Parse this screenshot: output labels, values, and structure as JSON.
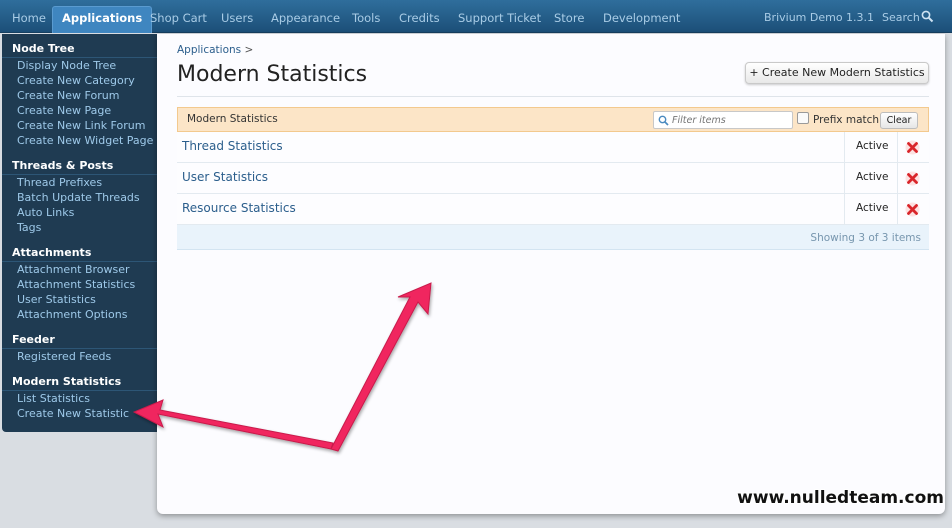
{
  "topnav": {
    "tabs": [
      {
        "label": "Home"
      },
      {
        "label": "Applications"
      },
      {
        "label": "Shop Cart"
      },
      {
        "label": "Users"
      },
      {
        "label": "Appearance"
      },
      {
        "label": "Tools"
      },
      {
        "label": "Credits"
      },
      {
        "label": "Support Ticket"
      },
      {
        "label": "Store"
      },
      {
        "label": "Development"
      }
    ],
    "active_tab": "Applications",
    "site_name": "Brivium Demo 1.3.1",
    "search_label": "Search",
    "search_icon": "magnifier-icon"
  },
  "sidebar": {
    "sections": [
      {
        "title": "Node Tree",
        "links": [
          "Display Node Tree",
          "Create New Category",
          "Create New Forum",
          "Create New Page",
          "Create New Link Forum",
          "Create New Widget Page"
        ]
      },
      {
        "title": "Threads & Posts",
        "links": [
          "Thread Prefixes",
          "Batch Update Threads",
          "Auto Links",
          "Tags"
        ]
      },
      {
        "title": "Attachments",
        "links": [
          "Attachment Browser",
          "Attachment Statistics",
          "User Statistics",
          "Attachment Options"
        ]
      },
      {
        "title": "Feeder",
        "links": [
          "Registered Feeds"
        ]
      },
      {
        "title": "Modern Statistics",
        "links": [
          "List Statistics",
          "Create New Statistic"
        ]
      }
    ]
  },
  "main": {
    "breadcrumb": [
      {
        "label": "Applications"
      }
    ],
    "breadcrumb_separator": ">",
    "title": "Modern Statistics",
    "create_button": "+ Create New Modern Statistics",
    "list": {
      "header_title": "Modern Statistics",
      "filter_placeholder": "Filter items",
      "prefix_match_label": "Prefix match",
      "prefix_match_checked": false,
      "clear_label": "Clear",
      "rows": [
        {
          "name": "Thread Statistics",
          "status": "Active"
        },
        {
          "name": "User Statistics",
          "status": "Active"
        },
        {
          "name": "Resource Statistics",
          "status": "Active"
        }
      ],
      "footer": "Showing 3 of 3 items"
    }
  },
  "watermark": "www.nulledteam.com",
  "colors": {
    "topbar": "#1c4f78",
    "active_tab": "#3f86c0",
    "sidebar_bg": "#1f3b52",
    "link": "#2b5e8c",
    "list_header_bg": "#fce5c7",
    "delete_icon": "#d9262b",
    "annotation_arrow": "#f0275f"
  }
}
